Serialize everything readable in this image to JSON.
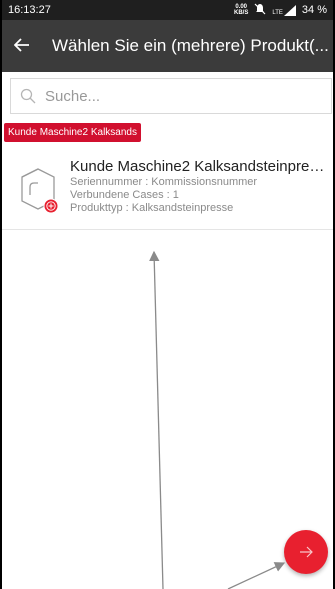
{
  "status": {
    "time": "16:13:27",
    "speed_value": "0.00",
    "speed_unit": "KB/S",
    "network": "LTE",
    "battery": "34 %"
  },
  "appbar": {
    "title": "Wählen Sie ein (mehrere) Produkt(..."
  },
  "search": {
    "placeholder": "Suche..."
  },
  "filter_chip": {
    "label": "Kunde Maschine2 Kalksands"
  },
  "product": {
    "name": "Kunde Maschine2 Kalksandsteinpres...",
    "serial": "Seriennummer : Kommissionsnummer",
    "cases": "Verbundene Cases : 1",
    "type": "Produkttyp : Kalksandsteinpresse"
  },
  "colors": {
    "accent": "#e8202f",
    "appbar": "#3b3b3b",
    "statusbar": "#1f1f1f"
  },
  "icons": {
    "back": "arrow-left-icon",
    "search": "search-icon",
    "fab": "arrow-right-icon",
    "product": "box-icon",
    "add": "plus-circle-icon"
  }
}
